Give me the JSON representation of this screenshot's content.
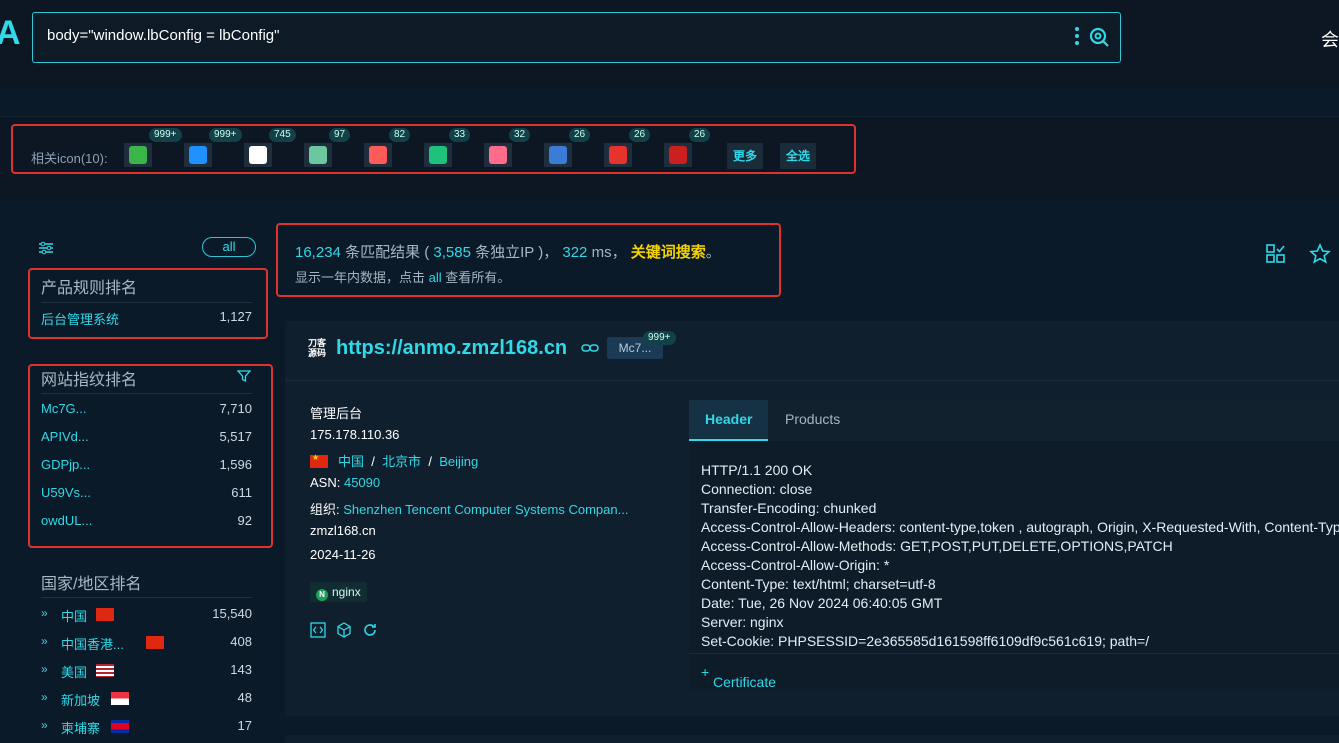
{
  "search": {
    "query": "body=\"window.lbConfig = lbConfig\"",
    "logo": "A",
    "right_char": "会"
  },
  "iconbar": {
    "label": "相关icon(10):",
    "icons": [
      {
        "name": "icon-1",
        "count": "999+",
        "color": "#3bb54a"
      },
      {
        "name": "icon-2",
        "count": "999+",
        "color": "#1e90ff"
      },
      {
        "name": "icon-3",
        "count": "745",
        "color": "#ffffff"
      },
      {
        "name": "icon-4",
        "count": "97",
        "color": "#6bc7a0"
      },
      {
        "name": "icon-5",
        "count": "82",
        "color": "#ff5a5a"
      },
      {
        "name": "icon-6",
        "count": "33",
        "color": "#1ec27a"
      },
      {
        "name": "icon-7",
        "count": "32",
        "color": "#ff6b8a"
      },
      {
        "name": "icon-8",
        "count": "26",
        "color": "#3a7bd5"
      },
      {
        "name": "icon-9",
        "count": "26",
        "color": "#e8322e"
      },
      {
        "name": "icon-10",
        "count": "26",
        "color": "#cc1f1f"
      }
    ],
    "more": "更多",
    "select_all": "全选"
  },
  "sidebar": {
    "all": "all",
    "product_title": "产品规则排名",
    "product_rows": [
      {
        "name": "后台管理系统",
        "value": "1,127"
      }
    ],
    "fp_title": "网站指纹排名",
    "fp_rows": [
      {
        "name": "Mc7G...",
        "value": "7,710"
      },
      {
        "name": "APIVd...",
        "value": "5,517"
      },
      {
        "name": "GDPjp...",
        "value": "1,596"
      },
      {
        "name": "U59Vs...",
        "value": "611"
      },
      {
        "name": "owdUL...",
        "value": "92"
      }
    ],
    "country_title": "国家/地区排名",
    "country_rows": [
      {
        "name": "中国",
        "value": "15,540",
        "flag": "cn"
      },
      {
        "name": "中国香港...",
        "value": "408",
        "flag": "hk"
      },
      {
        "name": "美国",
        "value": "143",
        "flag": "us"
      },
      {
        "name": "新加坡",
        "value": "48",
        "flag": "sg"
      },
      {
        "name": "柬埔寨",
        "value": "17",
        "flag": "kh"
      }
    ]
  },
  "summary": {
    "matches": "16,234",
    "matches_label": "条匹配结果 (",
    "ips": "3,585",
    "ips_label": "条独立IP )，",
    "ms": "322",
    "ms_label": "ms，",
    "keyword": "关键词搜索",
    "end": "。",
    "line2_a": "显示一年内数据，点击",
    "line2_link": "all",
    "line2_b": "查看所有。"
  },
  "result": {
    "logo_text": "刀客\n源码",
    "url": "https://anmo.zmzl168.cn",
    "tag": "Mc7...",
    "tag_count": "999+",
    "title": "管理后台",
    "ip": "175.178.110.36",
    "country": "中国",
    "region": "北京市",
    "city": "Beijing",
    "sep": "/",
    "asn_label": "ASN:",
    "asn": "45090",
    "org_label": "组织:",
    "org": "Shenzhen Tencent Computer Systems Compan...",
    "domain": "zmzl168.cn",
    "date": "2024-11-26",
    "server_tag": "nginx",
    "tab_header": "Header",
    "tab_products": "Products",
    "header_lines": [
      "HTTP/1.1 200 OK",
      "Connection: close",
      "Transfer-Encoding: chunked",
      "Access-Control-Allow-Headers: content-type,token , autograph, Origin, X-Requested-With, Content-Type",
      "Access-Control-Allow-Methods: GET,POST,PUT,DELETE,OPTIONS,PATCH",
      "Access-Control-Allow-Origin: *",
      "Content-Type: text/html; charset=utf-8",
      "Date: Tue, 26 Nov 2024 06:40:05 GMT",
      "Server: nginx",
      "Set-Cookie: PHPSESSID=2e365585d161598ff6109df9c561c619; path=/"
    ],
    "certificate": "Certificate"
  }
}
